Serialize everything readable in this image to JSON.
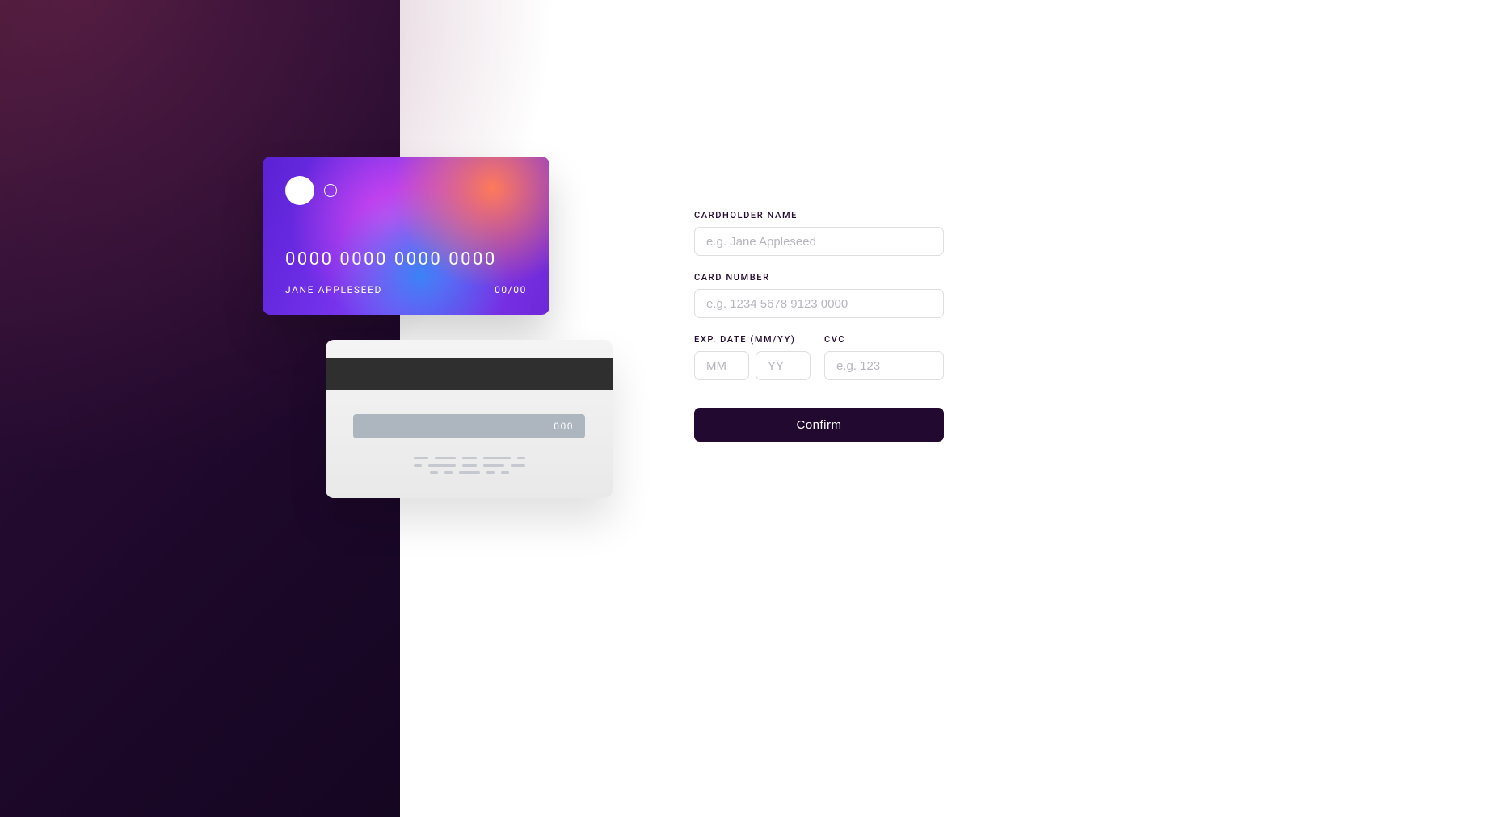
{
  "card": {
    "number_display": "0000 0000 0000 0000",
    "name_display": "JANE APPLESEED",
    "expiry_display": "00/00",
    "cvc_display": "000"
  },
  "form": {
    "name_label": "Cardholder Name",
    "name_placeholder": "e.g. Jane Appleseed",
    "name_value": "",
    "number_label": "Card Number",
    "number_placeholder": "e.g. 1234 5678 9123 0000",
    "number_value": "",
    "expiry_label": "Exp. Date (MM/YY)",
    "mm_placeholder": "MM",
    "mm_value": "",
    "yy_placeholder": "YY",
    "yy_value": "",
    "cvc_label": "CVC",
    "cvc_placeholder": "e.g. 123",
    "cvc_value": "",
    "submit_label": "Confirm"
  },
  "colors": {
    "accent_dark": "#21092F",
    "border": "#DEDDDF"
  }
}
